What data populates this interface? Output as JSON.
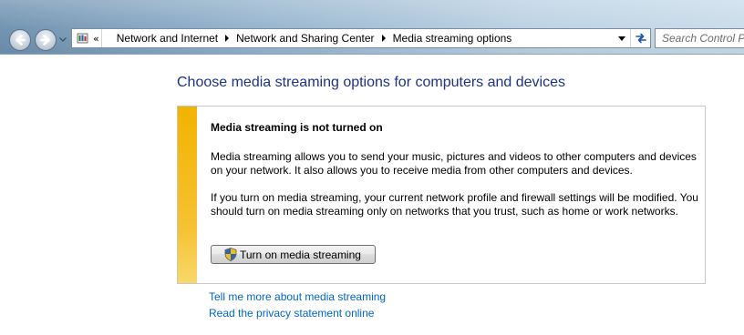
{
  "navigation": {
    "back_label": "Back",
    "forward_label": "Forward",
    "overflow_chevron": "«",
    "breadcrumbs": [
      {
        "label": "Network and Internet"
      },
      {
        "label": "Network and Sharing Center"
      },
      {
        "label": "Media streaming options"
      }
    ],
    "search_placeholder": "Search Control Panel"
  },
  "main": {
    "title": "Choose media streaming options for computers and devices",
    "notice": {
      "heading": "Media streaming is not turned on",
      "paragraph1": "Media streaming allows you to send your music, pictures and videos to other computers and devices on your network.  It also allows you to receive media from other computers and devices.",
      "paragraph2": "If you turn on media streaming, your current network profile and firewall settings will be modified. You should turn on media streaming only on networks that you trust, such as home or work networks.",
      "button_label": "Turn on media streaming",
      "stripe_color": "#f2b300"
    },
    "links": [
      {
        "label": "Tell me more about media streaming"
      },
      {
        "label": "Read the privacy statement online"
      }
    ],
    "title_color": "#1e3287",
    "link_color": "#0066cc"
  },
  "icons": {
    "address": "control-panel-icon",
    "button": "uac-shield-icon",
    "refresh": "refresh-icon"
  }
}
